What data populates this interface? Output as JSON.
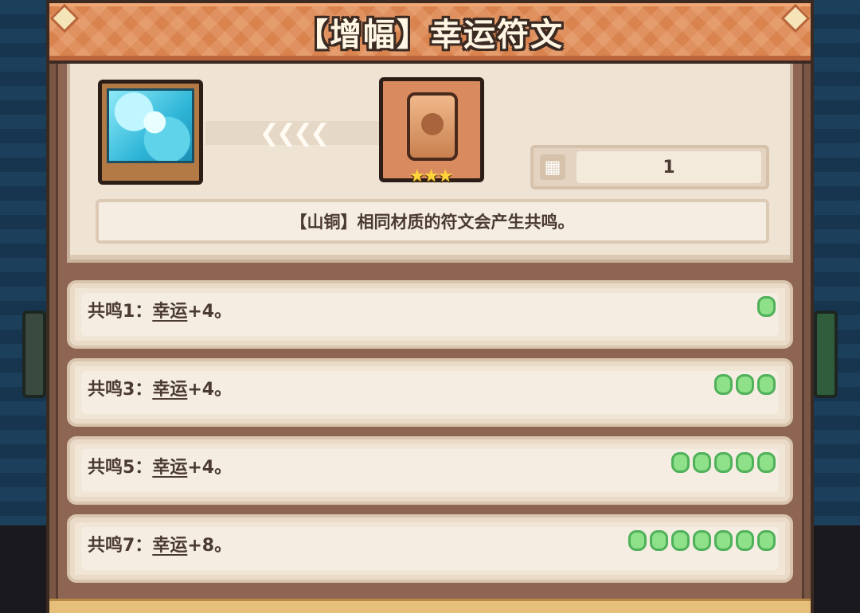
{
  "header": {
    "title": "【增幅】幸运符文"
  },
  "item": {
    "stars": "★★★",
    "count": "1",
    "count_icon": "grid-icon",
    "description": "【山铜】相同材质的符文会产生共鸣。"
  },
  "resonances": [
    {
      "prefix": "共鸣1：",
      "key": "幸运",
      "suffix": "+4。",
      "pips": 1
    },
    {
      "prefix": "共鸣3：",
      "key": "幸运",
      "suffix": "+4。",
      "pips": 3
    },
    {
      "prefix": "共鸣5：",
      "key": "幸运",
      "suffix": "+4。",
      "pips": 5
    },
    {
      "prefix": "共鸣7：",
      "key": "幸运",
      "suffix": "+8。",
      "pips": 7
    }
  ],
  "colors": {
    "pip_green": "#8ee089",
    "header_orange": "#d9834f",
    "panel_brown": "#7a5644"
  }
}
